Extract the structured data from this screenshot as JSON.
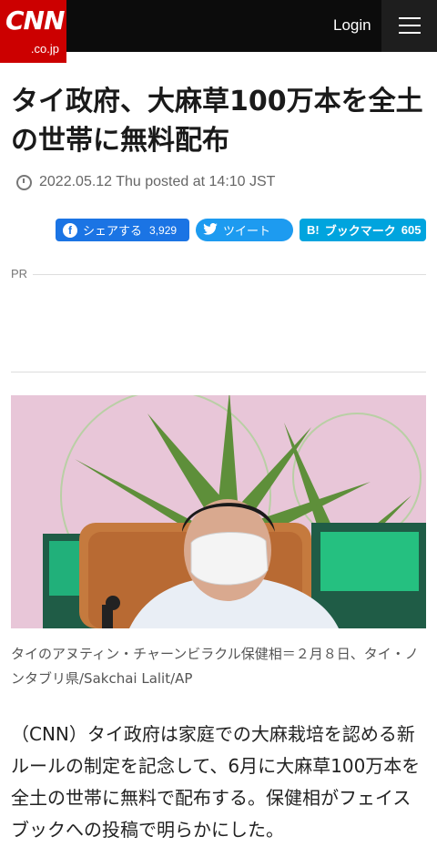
{
  "header": {
    "logo_text": "CNN",
    "logo_sub": ".co.jp",
    "login_label": "Login",
    "menu_icon": "hamburger-menu-icon"
  },
  "article": {
    "title": "タイ政府、大麻草100万本を全土の世帯に無料配布",
    "date": "2022.05.12 Thu posted at 14:10 JST",
    "share": {
      "facebook_label": "シェアする",
      "facebook_count": "3,929",
      "twitter_label": "ツイート",
      "hatena_icon_text": "B!",
      "hatena_label": "ブックマーク",
      "hatena_count": "605"
    },
    "pr_label": "PR",
    "photo_caption": "タイのアヌティン・チャーンビラクル保健相＝２月８日、タイ・ノンタブリ県/Sakchai Lalit/AP",
    "body": "（CNN）タイ政府は家庭での大麻栽培を認める新ルールの制定を記念して、6月に大麻草100万本を全土の世帯に無料で配布する。保健相がフェイスブックへの投稿で明らかにした。"
  },
  "colors": {
    "brand_red": "#cc0000",
    "facebook": "#1b74e4",
    "twitter": "#1d9bf0",
    "hatena": "#00a4de"
  }
}
